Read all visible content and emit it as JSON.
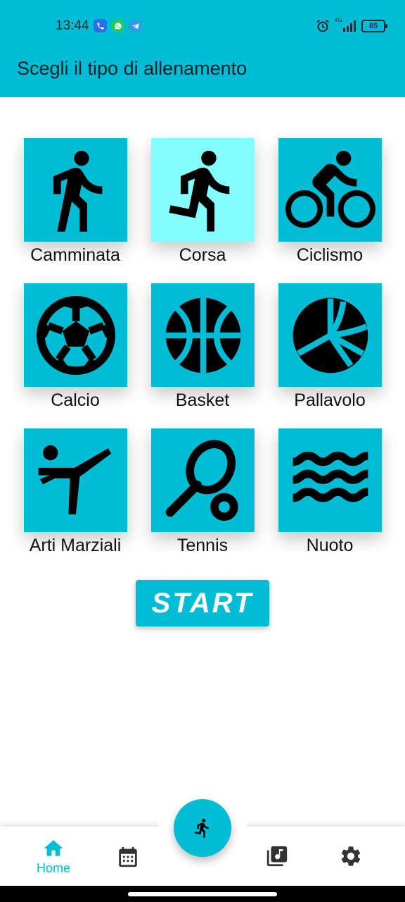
{
  "status": {
    "time": "13:44",
    "network": "4G",
    "battery": "85"
  },
  "header": {
    "title": "Scegli il tipo di allenamento"
  },
  "activities": [
    {
      "label": "Camminata",
      "icon": "walking-icon",
      "selected": false
    },
    {
      "label": "Corsa",
      "icon": "running-icon",
      "selected": true
    },
    {
      "label": "Ciclismo",
      "icon": "cycling-icon",
      "selected": false
    },
    {
      "label": "Calcio",
      "icon": "soccer-ball-icon",
      "selected": false
    },
    {
      "label": "Basket",
      "icon": "basketball-icon",
      "selected": false
    },
    {
      "label": "Pallavolo",
      "icon": "volleyball-icon",
      "selected": false
    },
    {
      "label": "Arti Marziali",
      "icon": "martial-arts-icon",
      "selected": false
    },
    {
      "label": "Tennis",
      "icon": "tennis-icon",
      "selected": false
    },
    {
      "label": "Nuoto",
      "icon": "swimming-icon",
      "selected": false
    }
  ],
  "start_button": {
    "label": "START"
  },
  "bottom_nav": {
    "home_label": "Home",
    "items": [
      "home-icon",
      "calendar-icon",
      "music-library-icon",
      "settings-gear-icon"
    ]
  },
  "colors": {
    "primary": "#00bcd4",
    "selected_tile": "#84ffff",
    "text": "#111111"
  }
}
